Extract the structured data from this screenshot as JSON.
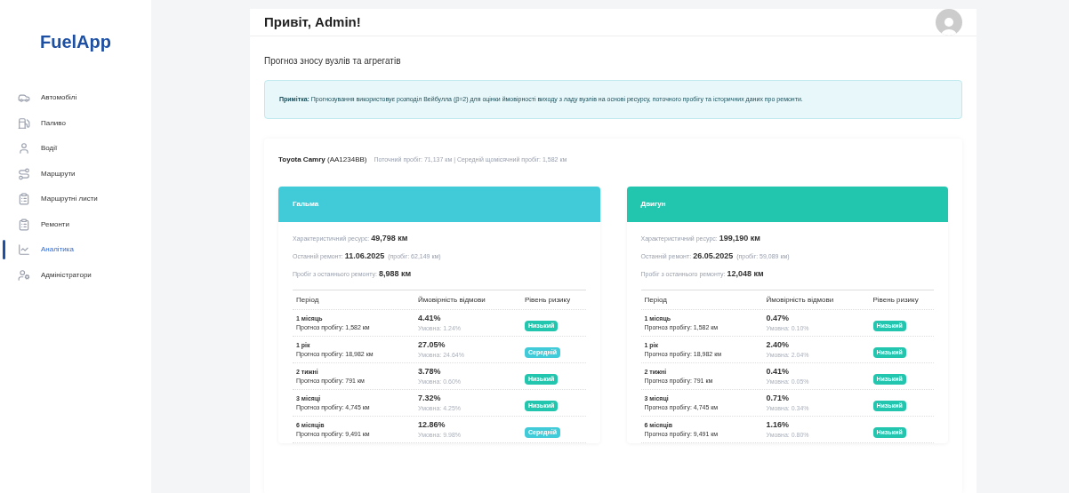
{
  "brand": "FuelApp",
  "sidebar": {
    "items": [
      {
        "label": "Автомобілі",
        "selected": false
      },
      {
        "label": "Паливо",
        "selected": false
      },
      {
        "label": "Водії",
        "selected": false
      },
      {
        "label": "Маршрути",
        "selected": false
      },
      {
        "label": "Маршрутні листи",
        "selected": false
      },
      {
        "label": "Ремонти",
        "selected": false
      },
      {
        "label": "Аналітика",
        "selected": true
      },
      {
        "label": "Адміністратори",
        "selected": false
      }
    ]
  },
  "header": {
    "greeting": "Привіт, Admin!"
  },
  "page_title": "Прогноз зносу вузлів та агрегатів",
  "note": "**Примітка:** Прогнозування використовує розподіл Вейбулла (β=2) для оцінки ймовірності виходу з ладу вузлів на основі ресурсу, поточного пробігу та історичних даних про ремонти.",
  "vehicle": {
    "name": "Toyota Camry",
    "plate": "(AA1234BB)",
    "details": "Поточний пробіг: 71,137 км | Середній щомісячний пробіг: 1,582 км"
  },
  "components": [
    {
      "title": "Гальма",
      "color": "#41cad8",
      "columns": [
        "Період",
        "Ймовірність відмови",
        "Рівень ризику"
      ],
      "stats": [
        {
          "label": "Характеристичний ресурс:",
          "value": "49,798 км"
        },
        {
          "label": "Останній ремонт:",
          "value": "11.06.2025",
          "note": "(пробіг: 62,149 км)"
        },
        {
          "label": "Пробіг з останнього ремонту:",
          "value": "8,988 км"
        }
      ],
      "rows": [
        {
          "period": "1 місяць",
          "forecast": "Прогноз пробігу: 1,582 км",
          "probability": "4.41%",
          "conditional": "Умовна: 1.24%",
          "risk": "Низький",
          "kind": "low"
        },
        {
          "period": "1 рік",
          "forecast": "Прогноз пробігу: 18,982 км",
          "probability": "27.05%",
          "conditional": "Умовна: 24.64%",
          "risk": "Середній",
          "kind": "medium"
        },
        {
          "period": "2 тижні",
          "forecast": "Прогноз пробігу: 791 км",
          "probability": "3.78%",
          "conditional": "Умовна: 0.60%",
          "risk": "Низький",
          "kind": "low"
        },
        {
          "period": "3 місяці",
          "forecast": "Прогноз пробігу: 4,745 км",
          "probability": "7.32%",
          "conditional": "Умовна: 4.25%",
          "risk": "Низький",
          "kind": "low"
        },
        {
          "period": "6 місяців",
          "forecast": "Прогноз пробігу: 9,491 км",
          "probability": "12.86%",
          "conditional": "Умовна: 9.98%",
          "risk": "Середній",
          "kind": "medium"
        }
      ]
    },
    {
      "title": "Двигун",
      "color": "#22c5ad",
      "columns": [
        "Період",
        "Ймовірність відмови",
        "Рівень ризику"
      ],
      "stats": [
        {
          "label": "Характеристичний ресурс:",
          "value": "199,190 км"
        },
        {
          "label": "Останній ремонт:",
          "value": "26.05.2025",
          "note": "(пробіг: 59,089 км)"
        },
        {
          "label": "Пробіг з останнього ремонту:",
          "value": "12,048 км"
        }
      ],
      "rows": [
        {
          "period": "1 місяць",
          "forecast": "Прогноз пробігу: 1,582 км",
          "probability": "0.47%",
          "conditional": "Умовна: 0.10%",
          "risk": "Низький",
          "kind": "low"
        },
        {
          "period": "1 рік",
          "forecast": "Прогноз пробігу: 18,982 км",
          "probability": "2.40%",
          "conditional": "Умовна: 2.04%",
          "risk": "Низький",
          "kind": "low"
        },
        {
          "period": "2 тижні",
          "forecast": "Прогноз пробігу: 791 км",
          "probability": "0.41%",
          "conditional": "Умовна: 0.05%",
          "risk": "Низький",
          "kind": "low"
        },
        {
          "period": "3 місяці",
          "forecast": "Прогноз пробігу: 4,745 км",
          "probability": "0.71%",
          "conditional": "Умовна: 0.34%",
          "risk": "Низький",
          "kind": "low"
        },
        {
          "period": "6 місяців",
          "forecast": "Прогноз пробігу: 9,491 км",
          "probability": "1.16%",
          "conditional": "Умовна: 0.80%",
          "risk": "Низький",
          "kind": "low"
        }
      ]
    }
  ]
}
